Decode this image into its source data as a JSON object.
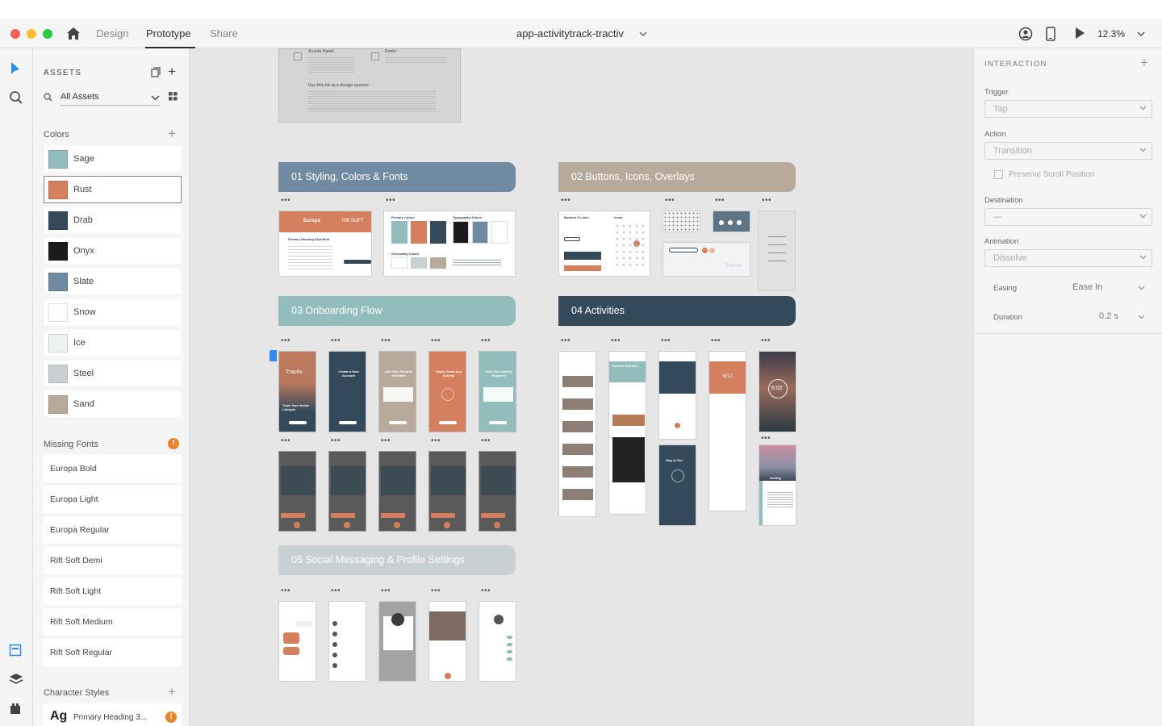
{
  "titlebar": {
    "tabs": [
      "Design",
      "Prototype",
      "Share"
    ],
    "active_tab": "Prototype",
    "document_title": "app-activitytrack-tractiv",
    "zoom": "12.3%"
  },
  "assets": {
    "title": "ASSETS",
    "filter": "All Assets",
    "colors_title": "Colors",
    "colors": [
      {
        "name": "Sage",
        "hex": "#93bcbd"
      },
      {
        "name": "Rust",
        "hex": "#d4805e"
      },
      {
        "name": "Drab",
        "hex": "#34495a"
      },
      {
        "name": "Onyx",
        "hex": "#1b1b1d"
      },
      {
        "name": "Slate",
        "hex": "#6f8aa1"
      },
      {
        "name": "Snow",
        "hex": "#ffffff"
      },
      {
        "name": "Ice",
        "hex": "#eef1f2"
      },
      {
        "name": "Steel",
        "hex": "#c9d0d3"
      },
      {
        "name": "Sand",
        "hex": "#b8aa9b"
      }
    ],
    "selected_color": "Rust",
    "missing_fonts_title": "Missing Fonts",
    "missing_fonts": [
      "Europa Bold",
      "Europa Light",
      "Europa Regular",
      "Rift Soft Demi",
      "Rift Soft Light",
      "Rift Soft Medium",
      "Rift Soft Regular"
    ],
    "character_styles_title": "Character Styles",
    "character_style": {
      "glyph": "Ag",
      "name": "Primary Heading 3..."
    }
  },
  "canvas": {
    "sections": [
      {
        "label": "01 Styling, Colors & Fonts",
        "color": "#6f8aa1"
      },
      {
        "label": "02 Buttons, Icons, Overlays",
        "color": "#b8aa9b"
      },
      {
        "label": "03 Onboarding Flow",
        "color": "#93bcbd"
      },
      {
        "label": "04 Activities",
        "color": "#34495a"
      },
      {
        "label": "05 Social Messaging & Profile Settings",
        "color": "#c9d0d3"
      }
    ],
    "card_texts": {
      "assets_panel": "Assets Panel:",
      "fonts": "Fonts:",
      "design_system": "Use this kit as a design system:",
      "europa": "Europa",
      "rift": "Rift SOFT",
      "primary_heading": "Primary Heading 32pt Bold",
      "primary_colors": "Primary Colors",
      "typography_colors": "Typography Colors",
      "secondary_colors": "Secondary Colors",
      "buttons_links": "Buttons & Links",
      "icons": "Icons",
      "tractiv": "Tractiv",
      "onboarding_1": "Track Your Active Lifestyle",
      "onboarding_2": "Create a New Account",
      "onboarding_3": "Add Your Favorite Activities",
      "onboarding_4": "Easily Track Any Activity",
      "onboarding_5": "View Your Weekly Progress",
      "timer": "6:02",
      "counter": "6/12",
      "surfing": "Surfing",
      "discover": "Discover Activities",
      "way_to_go": "Way to Go!"
    }
  },
  "inspector": {
    "title": "INTERACTION",
    "trigger_label": "Trigger",
    "trigger_value": "Tap",
    "action_label": "Action",
    "action_value": "Transition",
    "preserve_label": "Preserve Scroll Position",
    "destination_label": "Destination",
    "destination_value": "—",
    "animation_label": "Animation",
    "animation_value": "Dissolve",
    "easing_label": "Easing",
    "easing_value": "Ease In",
    "duration_label": "Duration",
    "duration_value": "0.2 s"
  }
}
